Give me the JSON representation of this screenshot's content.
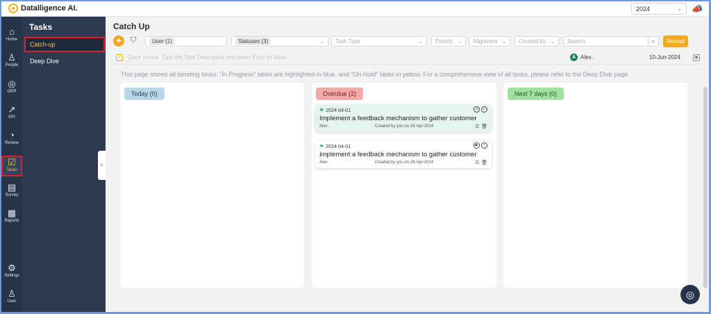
{
  "app": {
    "brand": "Datalligence AI."
  },
  "topbar": {
    "year": "2024"
  },
  "rail": [
    {
      "label": "Home",
      "icon": "⌂"
    },
    {
      "label": "People",
      "icon": "♙"
    },
    {
      "label": "OKR",
      "icon": "◎"
    },
    {
      "label": "KPI",
      "icon": "↗"
    },
    {
      "label": "Review",
      "icon": "◔"
    },
    {
      "label": "Tasks",
      "icon": "☑"
    },
    {
      "label": "Survey",
      "icon": "▤"
    },
    {
      "label": "Reports",
      "icon": "▦"
    },
    {
      "label": "Settings",
      "icon": "⚙"
    },
    {
      "label": "User",
      "icon": "♙"
    }
  ],
  "sidebar": {
    "title": "Tasks",
    "items": [
      {
        "label": "Catch-up"
      },
      {
        "label": "Deep Dive"
      }
    ]
  },
  "page": {
    "title": "Catch Up"
  },
  "filters": {
    "user": "User (1)",
    "statuses": "Statuses (3)",
    "task_type": "Task Type",
    "priority": "Priority",
    "alignment": "Alignment",
    "created_by": "Created by",
    "search_placeholder": "Search",
    "reload": "Reload"
  },
  "quick_create": {
    "placeholder": "Quick create: Type the Task Description and press Enter to Save",
    "assignee_initial": "A",
    "assignee": "Alex .",
    "date": "10-Jun-2024"
  },
  "info": "This page shows all pending tasks: \"In Progress\" tasks are highlighted in blue, and \"On Hold\" tasks in yellow. For a comprehensive view of all tasks, please refer to the Deep Dive page.",
  "columns": {
    "today": {
      "label": "Today (0)"
    },
    "overdue": {
      "label": "Overdue (2)",
      "cards": [
        {
          "date": "2024-04-01",
          "title": "Implement a feedback mechanism to gather customer",
          "owner": "Alex .",
          "created": "Created by you on 29-Apr-2024"
        },
        {
          "date": "2024-04-01",
          "title": "Implement a feedback mechanism to gather customer",
          "owner": "Alex .",
          "created": "Created by you on 29-Apr-2024"
        }
      ]
    },
    "next7": {
      "label": "Next 7 days (0)"
    }
  }
}
